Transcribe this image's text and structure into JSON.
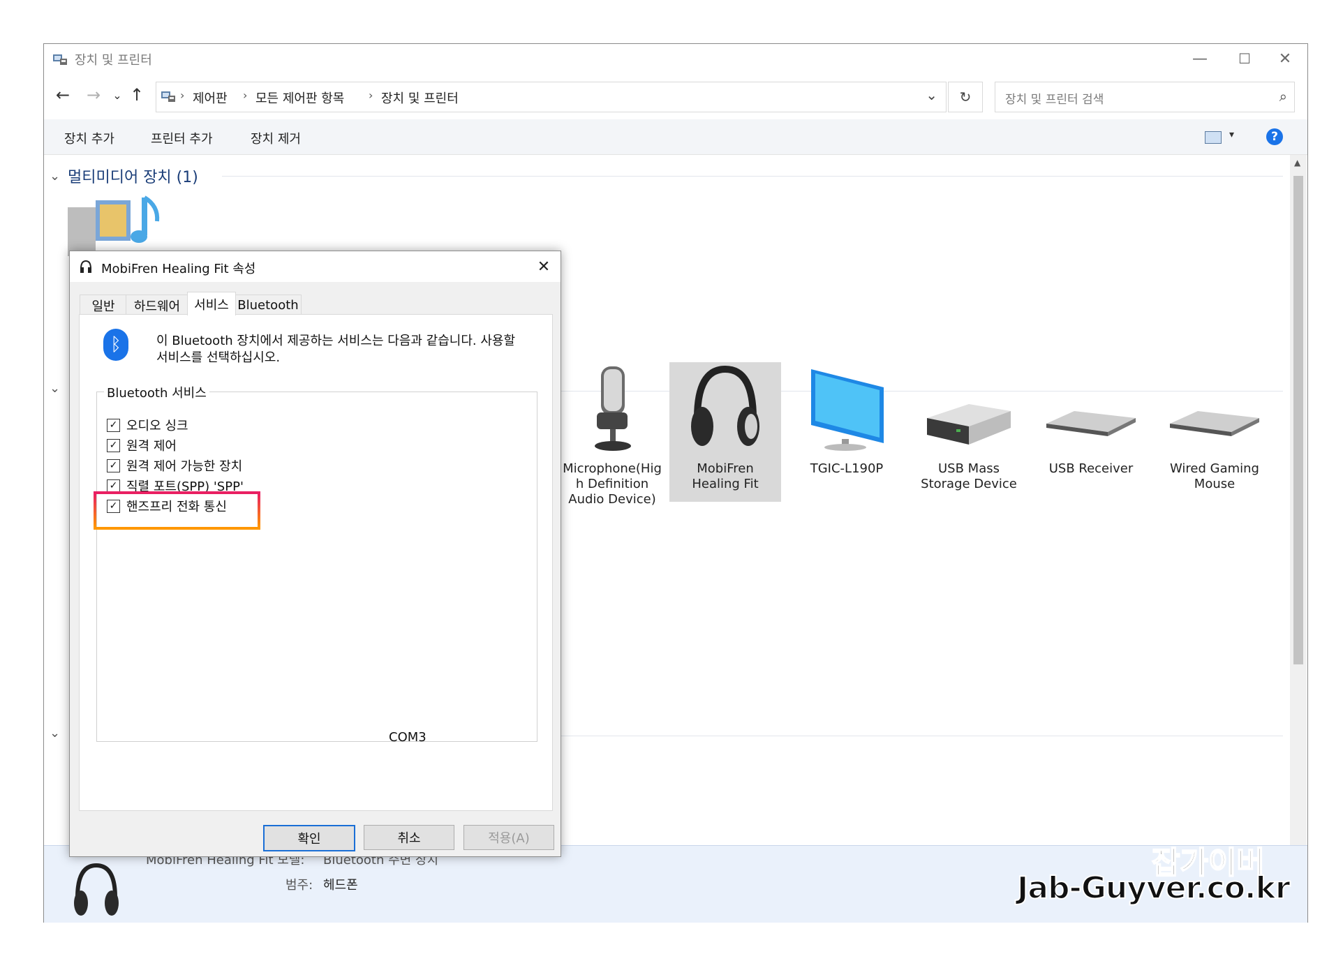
{
  "window": {
    "title": "장치 및 프린터",
    "min_glyph": "—",
    "max_glyph": "☐",
    "close_glyph": "✕"
  },
  "address": {
    "back_glyph": "←",
    "forward_glyph": "→",
    "recent_glyph": "⌄",
    "up_glyph": "↑",
    "breadcrumbs": [
      "제어판",
      "모든 제어판 항목",
      "장치 및 프린터"
    ],
    "breadcrumb_sep": "›",
    "dropdown_glyph": "⌄",
    "refresh_glyph": "↻",
    "search_placeholder": "장치 및 프린터 검색",
    "search_glyph": "⌕"
  },
  "toolbar": {
    "add_device": "장치 추가",
    "add_printer": "프린터 추가",
    "remove_device": "장치 제거",
    "view_dropdown_glyph": "▾",
    "help_glyph": "?"
  },
  "groups": {
    "multimedia": "멀티미디어 장치 (1)",
    "chevron_glyph": "⌄"
  },
  "devices": [
    {
      "label": "Microphone(High Definition Audio Device)",
      "line1": "Microphone(Hig",
      "line2": "h Definition",
      "line3": "Audio Device)",
      "icon": "microphone-icon"
    },
    {
      "label": "MobiFren Healing Fit",
      "line1": "MobiFren",
      "line2": "Healing Fit",
      "icon": "headphones-icon",
      "selected": true
    },
    {
      "label": "TGIC-L190P",
      "line1": "TGIC-L190P",
      "icon": "monitor-icon"
    },
    {
      "label": "USB Mass Storage Device",
      "line1": "USB Mass",
      "line2": "Storage Device",
      "icon": "drive-icon"
    },
    {
      "label": "USB Receiver",
      "line1": "USB Receiver",
      "icon": "keyboard-icon"
    },
    {
      "label": "Wired Gaming Mouse",
      "line1": "Wired Gaming",
      "line2": "Mouse",
      "icon": "keyboard-icon"
    }
  ],
  "details": {
    "name_partial": "MobiFren Healing Fit 모델:",
    "model_value": "Bluetooth 주변 장치",
    "category_label": "범주:",
    "category_value": "헤드폰"
  },
  "dialog": {
    "title": "MobiFren Healing Fit 속성",
    "close_glyph": "✕",
    "tabs": [
      "일반",
      "하드웨어",
      "서비스",
      "Bluetooth"
    ],
    "active_tab": "서비스",
    "bt_glyph": "ᛒ",
    "description_line1": "이 Bluetooth 장치에서 제공하는 서비스는 다음과 같습니다. 사용할",
    "description_line2": "서비스를 선택하십시오.",
    "services_legend": "Bluetooth 서비스",
    "services": [
      {
        "label": "오디오 싱크",
        "checked": true
      },
      {
        "label": "원격 제어",
        "checked": true
      },
      {
        "label": "원격 제어 가능한 장치",
        "checked": true
      },
      {
        "label": "직렬 포트(SPP) 'SPP'",
        "checked": true,
        "port": "COM3"
      },
      {
        "label": "핸즈프리 전화 통신",
        "checked": true,
        "highlighted": true
      }
    ],
    "check_glyph": "✓",
    "ok": "확인",
    "cancel": "취소",
    "apply": "적용(A)"
  },
  "watermark": {
    "line1": "잡가이버",
    "line2": "Jab-Guyver.co.kr"
  },
  "colors": {
    "accent": "#1a73e8",
    "highlight_top": "#e91e63",
    "highlight_bottom": "#ff9800",
    "selection": "#d9d9d9"
  }
}
